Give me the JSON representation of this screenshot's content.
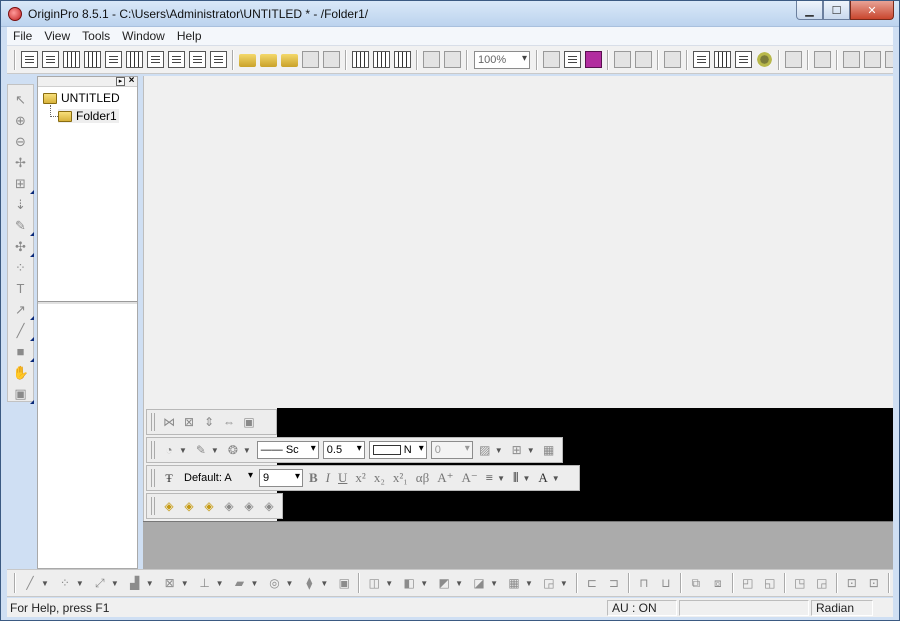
{
  "window": {
    "title": "OriginPro 8.5.1 - C:\\Users\\Administrator\\UNTITLED * - /Folder1/",
    "controls": {
      "minimize": "▁",
      "maximize": "☐",
      "close": "✕"
    }
  },
  "menu": [
    "File",
    "View",
    "Tools",
    "Window",
    "Help"
  ],
  "toolbar": {
    "zoom_value": "100%"
  },
  "explorer": {
    "root_label": "UNTITLED",
    "child_label": "Folder1",
    "pin_glyph": "▸",
    "close_glyph": "×"
  },
  "format_toolbar": {
    "line_style": "—— Sc",
    "line_width": "0.5",
    "color_label": "N",
    "transparency": "0",
    "font_name": "Default: A",
    "font_size": "9"
  },
  "statusbar": {
    "help_text": "For Help, press F1",
    "au_status": "AU : ON",
    "angle_unit": "Radian"
  },
  "icons": {
    "tools": [
      "pointer-icon",
      "zoom-in-icon",
      "zoom-out-icon",
      "screen-reader-icon",
      "data-reader-icon",
      "data-selector-icon",
      "draw-data-icon",
      "mask-icon",
      "regional-mask-icon",
      "text-tool-icon",
      "arrow-tool-icon",
      "line-tool-icon",
      "rectangle-tool-icon",
      "pan-hand-icon",
      "region-icon"
    ]
  }
}
